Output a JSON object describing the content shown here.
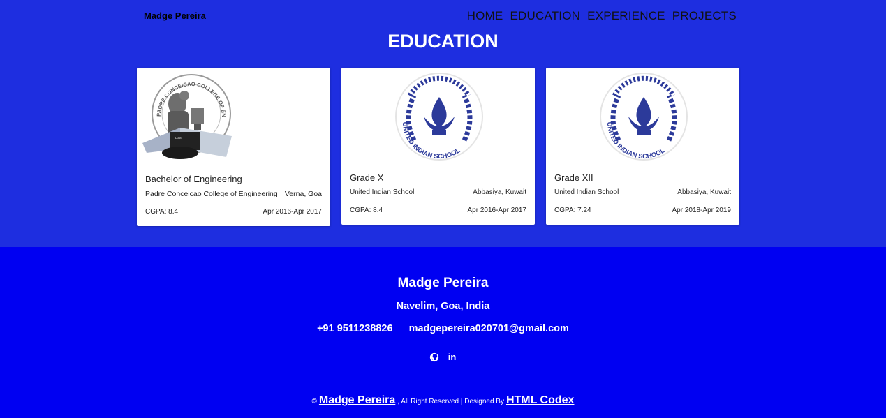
{
  "nav": {
    "brand": "Madge Pereira",
    "items": [
      "HOME",
      "EDUCATION",
      "EXPERIENCE",
      "PROJECTS"
    ]
  },
  "section": {
    "title": "EDUCATION"
  },
  "cards": [
    {
      "degree": "Bachelor of Engineering",
      "school": "Padre Conceicao College of Engineering",
      "location": "Verna, Goa",
      "grade": "CGPA: 8.4",
      "period": "Apr 2016-Apr 2017",
      "logo": "padre-conceicao-college-logo",
      "logo_text": "PADRE CONCEICAO COLLEGE OF ENGINEERING"
    },
    {
      "degree": "Grade X",
      "school": "United Indian School",
      "location": "Abbasiya, Kuwait",
      "grade": "CGPA: 8.4",
      "period": "Apr 2016-Apr 2017",
      "logo": "united-indian-school-logo",
      "logo_text": "UNITED INDIAN SCHOOL"
    },
    {
      "degree": "Grade XII",
      "school": "United Indian School",
      "location": "Abbasiya, Kuwait",
      "grade": "CGPA: 7.24",
      "period": "Apr 2018-Apr 2019",
      "logo": "united-indian-school-logo",
      "logo_text": "UNITED INDIAN SCHOOL"
    }
  ],
  "footer": {
    "name": "Madge Pereira",
    "location": "Navelim, Goa, India",
    "phone": "+91 9511238826",
    "email": "madgepereira020701@gmail.com",
    "icons": [
      "github-icon",
      "linkedin-icon"
    ],
    "copyright_symbol": "©",
    "copy_name": "Madge Pereira",
    "copy_mid": ", All Right Reserved | Designed By",
    "copy_designer": "HTML Codex"
  },
  "colors": {
    "header_bg": "#1e2ee0",
    "footer_bg": "#0000f2",
    "logo_blue": "#2c3a9a"
  }
}
